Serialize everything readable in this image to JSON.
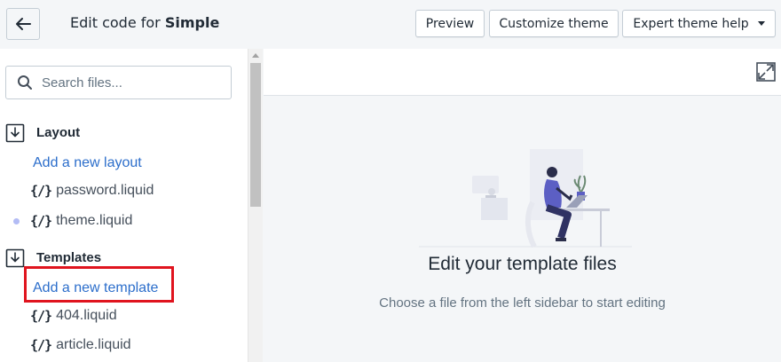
{
  "header": {
    "title_prefix": "Edit code for ",
    "theme_name": "Simple",
    "buttons": {
      "preview": "Preview",
      "customize": "Customize theme",
      "expert": "Expert theme help"
    }
  },
  "sidebar": {
    "search": {
      "placeholder": "Search files..."
    },
    "sections": {
      "layout": {
        "label": "Layout",
        "add_link": "Add a new layout",
        "files": [
          "password.liquid",
          "theme.liquid"
        ]
      },
      "templates": {
        "label": "Templates",
        "add_link": "Add a new template",
        "files": [
          "404.liquid",
          "article.liquid"
        ]
      }
    },
    "file_icon": "{/}"
  },
  "main": {
    "empty_title": "Edit your template files",
    "empty_subtitle": "Choose a file from the left sidebar to start editing"
  },
  "icons": {
    "back": "back-arrow-icon",
    "search": "search-icon",
    "folder": "folder-download-icon",
    "expand": "expand-icon",
    "dropdown": "caret-down-icon"
  },
  "colors": {
    "link": "#2c6ecb",
    "highlight": "#e0141e",
    "accent_dot": "#b3bcf5",
    "illustration": "#5c5fc4"
  }
}
